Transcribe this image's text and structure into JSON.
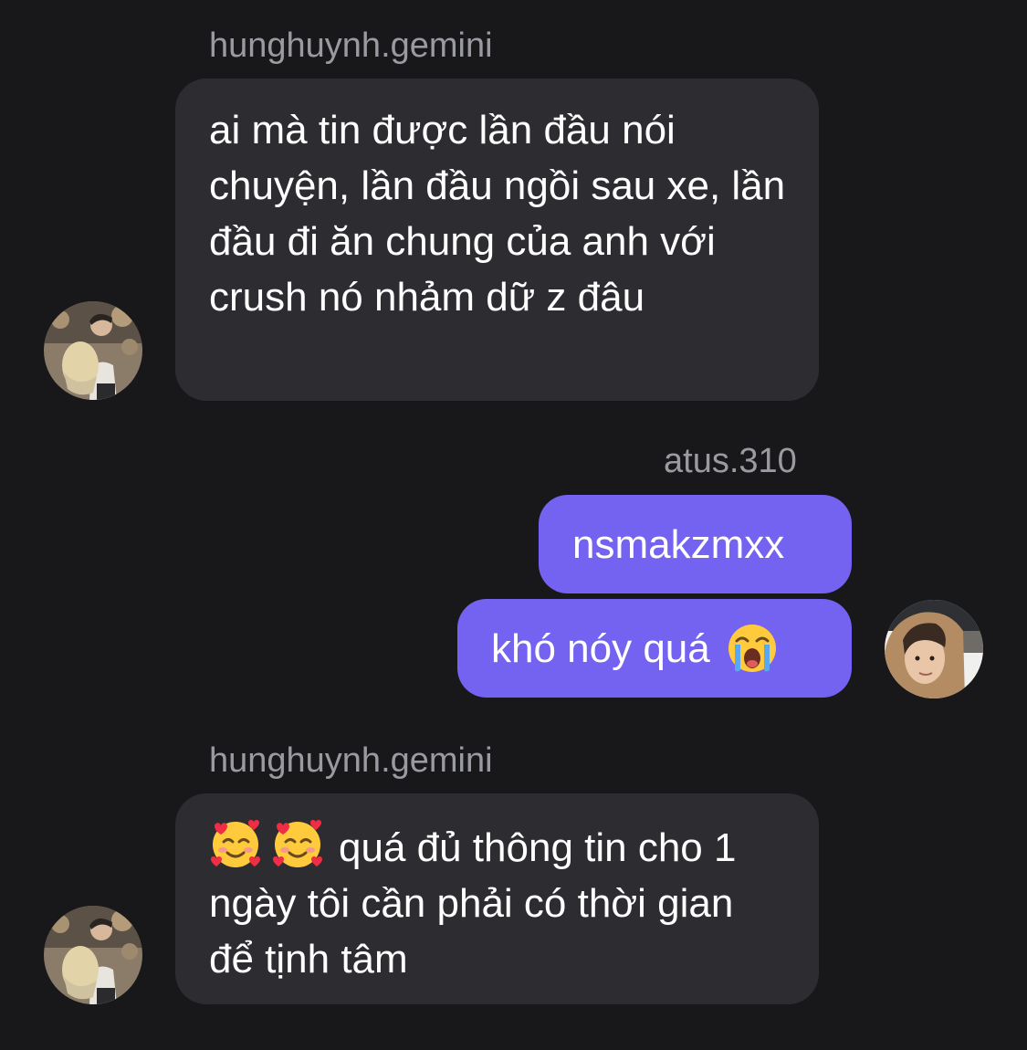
{
  "thread": {
    "messages": [
      {
        "sender": "hunghuynh.gemini",
        "direction": "incoming",
        "text": "ai mà tin được lần đầu nói chuyện, lần đầu ngồi sau xe, lần đầu đi ăn chung của anh với crush nó nhảm dữ z đâu",
        "avatar_icon": "avatar-hunghuynh-icon"
      },
      {
        "sender": "atus.310",
        "direction": "outgoing",
        "text": "nsmakzmxx"
      },
      {
        "sender": "atus.310",
        "direction": "outgoing",
        "text": "khó nóy quá",
        "trailing_emoji": "loudly-crying-face-icon",
        "avatar_icon": "avatar-atus-icon"
      },
      {
        "sender": "hunghuynh.gemini",
        "direction": "incoming",
        "leading_emojis": [
          "smiling-face-with-hearts-icon",
          "smiling-face-with-hearts-icon"
        ],
        "text": "quá đủ thông tin cho 1 ngày tôi cần phải có thời gian để tịnh tâm",
        "avatar_icon": "avatar-hunghuynh-icon"
      }
    ]
  },
  "colors": {
    "background": "#18181b",
    "incoming_bubble": "#2c2c31",
    "outgoing_bubble": "#7462f0",
    "sender_name": "#9a9aa1",
    "message_text": "#ffffff"
  }
}
